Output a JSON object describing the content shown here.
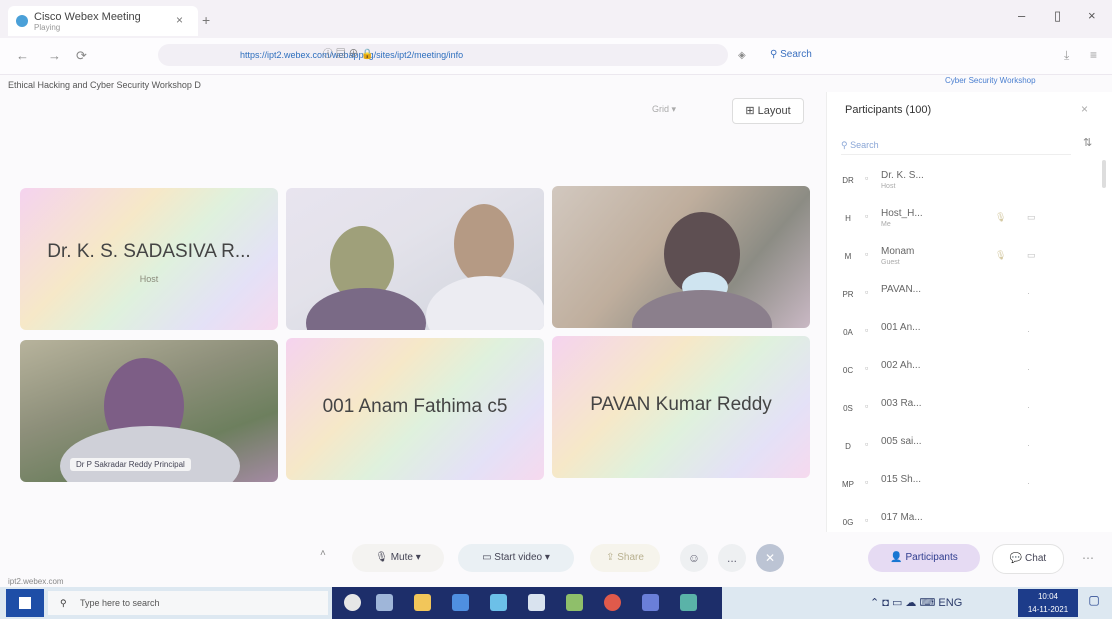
{
  "browser": {
    "tab_title": "Cisco Webex Meeting",
    "tab_subtitle": "Playing",
    "tab_close": "×",
    "new_tab": "+",
    "url": "https://ipt2.webex.com/webappng/sites/ipt2/meeting/info",
    "search_label": "Search",
    "minimize": "–",
    "maximize": "▯",
    "close": "×"
  },
  "meeting": {
    "title": "Ethical Hacking and Cyber Security Workshop D",
    "right_link": "Cyber Security Workshop",
    "view_selector": "Grid",
    "layout_label": "Layout"
  },
  "tiles": [
    {
      "name": "Dr. K. S. SADASIVA R...",
      "sub": "Host"
    },
    {
      "name": "001 Anam Fathima c5"
    },
    {
      "name": "PAVAN Kumar Reddy"
    },
    {
      "video_label": "Dr P Sakradar Reddy Principal"
    }
  ],
  "participants": {
    "title": "Participants (100)",
    "search_placeholder": "Search",
    "sort_icon": "⇅",
    "rows": [
      {
        "avatar": "DR",
        "name": "Dr. K. S...",
        "role": "Host"
      },
      {
        "avatar": "H",
        "name": "Host_H...",
        "role": "Me"
      },
      {
        "avatar": "M",
        "name": "Monam",
        "role": "Guest"
      },
      {
        "avatar": "PR",
        "name": "PAVAN..."
      },
      {
        "avatar": "0A",
        "name": "001 An..."
      },
      {
        "avatar": "0C",
        "name": "002 Ah..."
      },
      {
        "avatar": "0S",
        "name": "003 Ra..."
      },
      {
        "avatar": "D",
        "name": "005 sai..."
      },
      {
        "avatar": "MP",
        "name": "015 Sh..."
      },
      {
        "avatar": "0G",
        "name": "017 Ma..."
      }
    ]
  },
  "controls": {
    "mute": "Mute",
    "start_video": "Start video",
    "share": "Share",
    "participants": "Participants",
    "chat": "Chat",
    "more": "..."
  },
  "status_link": "ipt2.webex.com",
  "taskbar": {
    "search_placeholder": "Type here to search",
    "time": "10:04",
    "date": "14-11-2021"
  },
  "colors": {
    "taskbar_apps": "#1d2e6a",
    "participants_button": "#e6dbf3",
    "start_button": "#1e4ea7"
  }
}
